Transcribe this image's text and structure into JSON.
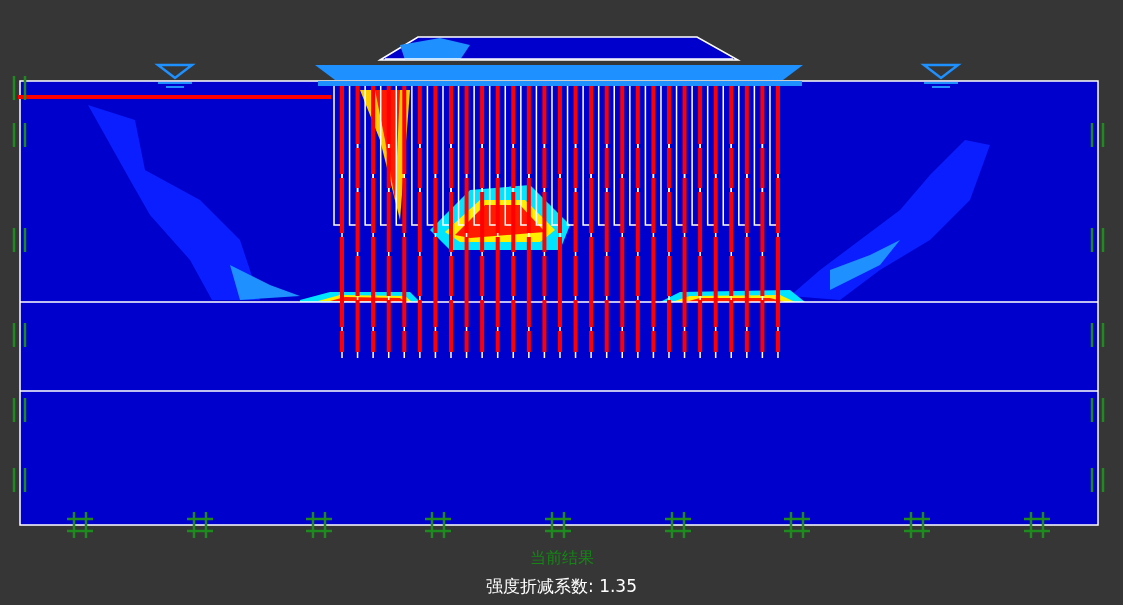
{
  "caption": "当前结果",
  "result": "强度折减系数: 1.35"
}
